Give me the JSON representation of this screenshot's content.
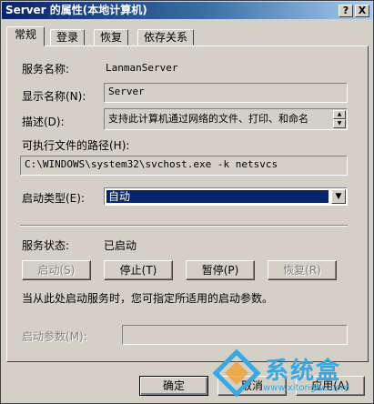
{
  "window": {
    "title": "Server 的属性(本地计算机)",
    "help_btn": "?",
    "close_btn": "X"
  },
  "tabs": [
    "常规",
    "登录",
    "恢复",
    "依存关系"
  ],
  "general": {
    "service_name_label": "服务名称:",
    "service_name_value": "LanmanServer",
    "display_name_label": "显示名称(N):",
    "display_name_value": "Server",
    "description_label": "描述(D):",
    "description_value": "支持此计算机通过网络的文件、打印、和命名",
    "path_label": "可执行文件的路径(H):",
    "path_value": "C:\\WINDOWS\\system32\\svchost.exe -k netsvcs",
    "startup_type_label": "启动类型(E):",
    "startup_type_value": "自动",
    "service_status_label": "服务状态:",
    "service_status_value": "已启动",
    "buttons": {
      "start": "启动(S)",
      "stop": "停止(T)",
      "pause": "暂停(P)",
      "resume": "恢复(R)"
    },
    "hint_text": "当从此处启动服务时，您可指定所适用的启动参数。",
    "start_params_label": "启动参数(M):",
    "start_params_value": ""
  },
  "footer": {
    "ok": "确定",
    "cancel": "取消",
    "apply": "应用(A)"
  },
  "watermark": {
    "text": "系统盒",
    "url": "www.xitonghe.com"
  },
  "colors": {
    "face": "#d4d0c8",
    "title_start": "#0a246a",
    "title_end": "#a6caf0",
    "selection": "#0a246a",
    "watermark": "#39a7e0"
  },
  "icons": {
    "help": "question-mark",
    "close": "x-mark",
    "dropdown": "chevron-down",
    "scroll_up": "triangle-up",
    "scroll_down": "triangle-down"
  }
}
